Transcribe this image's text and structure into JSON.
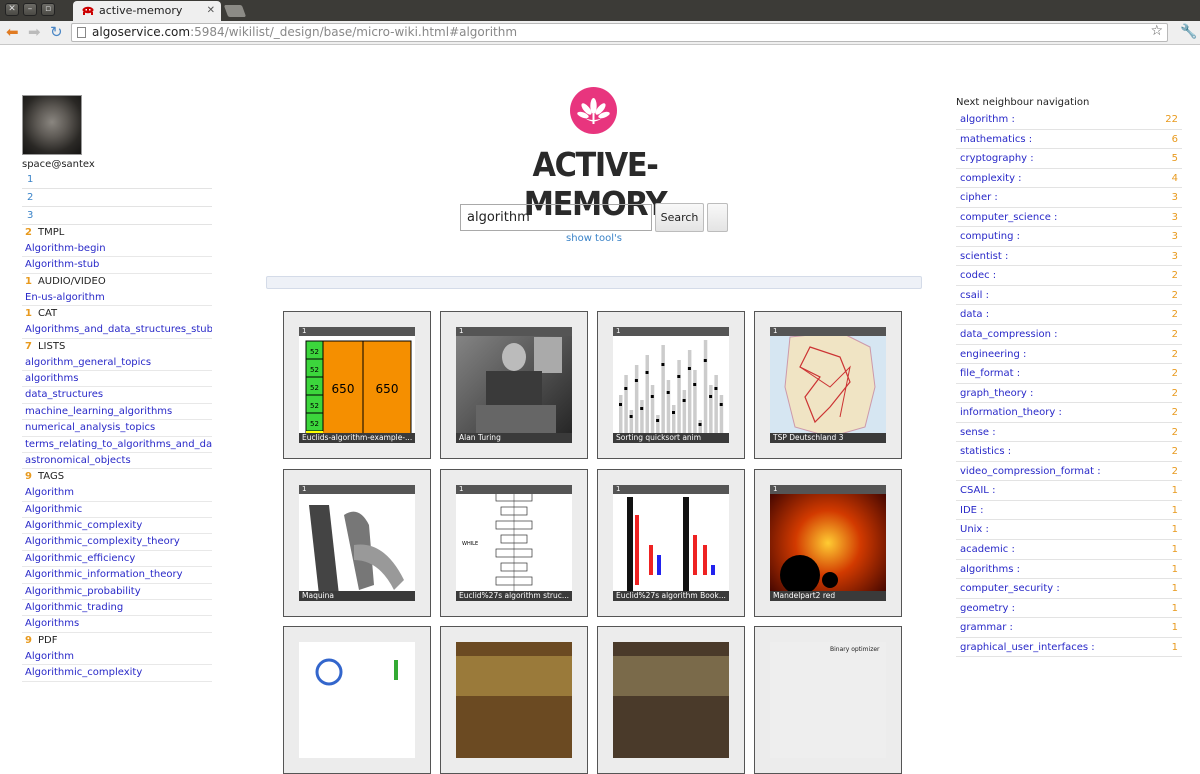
{
  "browser": {
    "tab_title": "active-memory",
    "url_host": "algoservice.com",
    "url_rest": ":5984/wikilist/_design/base/micro-wiki.html#algorithm"
  },
  "left": {
    "username": "space@santex",
    "pages": [
      "1",
      "2",
      "3"
    ],
    "sections": [
      {
        "count": "2",
        "name": "TMPL",
        "items": [
          "Algorithm-begin",
          "Algorithm-stub"
        ]
      },
      {
        "count": "1",
        "name": "AUDIO/VIDEO",
        "items": [
          "En-us-algorithm"
        ]
      },
      {
        "count": "1",
        "name": "CAT",
        "items": [
          "Algorithms_and_data_structures_stubs"
        ]
      },
      {
        "count": "7",
        "name": "LISTS",
        "items": [
          "algorithm_general_topics",
          "algorithms",
          "data_structures",
          "machine_learning_algorithms",
          "numerical_analysis_topics",
          "terms_relating_to_algorithms_and_data_stru",
          "astronomical_objects"
        ]
      },
      {
        "count": "9",
        "name": "TAGS",
        "items": [
          "Algorithm",
          "Algorithmic",
          "Algorithmic_complexity",
          "Algorithmic_complexity_theory",
          "Algorithmic_efficiency",
          "Algorithmic_information_theory",
          "Algorithmic_probability",
          "Algorithmic_trading",
          "Algorithms"
        ]
      },
      {
        "count": "9",
        "name": "PDF",
        "items": [
          "Algorithm",
          "Algorithmic_complexity"
        ]
      }
    ]
  },
  "center": {
    "logo_text": "ACTIVE-MEMORY",
    "search_value": "algorithm",
    "search_button": "Search",
    "show_tools": "show tool's",
    "cards": [
      {
        "badge": "1",
        "caption": "Euclids-algorithm-example-...",
        "icon": "euclid-bars-image"
      },
      {
        "badge": "1",
        "caption": "Alan Turing",
        "icon": "photo-image"
      },
      {
        "badge": "1",
        "caption": "Sorting quicksort anim",
        "icon": "sort-chart-image"
      },
      {
        "badge": "1",
        "caption": "TSP Deutschland 3",
        "icon": "map-image"
      },
      {
        "badge": "1",
        "caption": "Maquina",
        "icon": "machine-image"
      },
      {
        "badge": "1",
        "caption": "Euclid%27s algorithm struc...",
        "icon": "flowchart-image"
      },
      {
        "badge": "1",
        "caption": "Euclid%27s algorithm Book...",
        "icon": "bars-image"
      },
      {
        "badge": "1",
        "caption": "Mandelpart2 red",
        "icon": "fractal-image"
      },
      {
        "badge": "",
        "caption": "",
        "icon": "partial-image"
      },
      {
        "badge": "",
        "caption": "",
        "icon": "partial-image"
      },
      {
        "badge": "",
        "caption": "",
        "icon": "partial-image"
      },
      {
        "badge": "",
        "caption": "Binary optimizer",
        "icon": "partial-image"
      }
    ],
    "euclid_values": [
      "52",
      "52",
      "52",
      "52",
      "52",
      "650",
      "650"
    ]
  },
  "right": {
    "title": "Next neighbour navigation",
    "items": [
      {
        "label": "algorithm",
        "count": "22"
      },
      {
        "label": "mathematics",
        "count": "6"
      },
      {
        "label": "cryptography",
        "count": "5"
      },
      {
        "label": "complexity",
        "count": "4"
      },
      {
        "label": "cipher",
        "count": "3"
      },
      {
        "label": "computer_science",
        "count": "3"
      },
      {
        "label": "computing",
        "count": "3"
      },
      {
        "label": "scientist",
        "count": "3"
      },
      {
        "label": "codec",
        "count": "2"
      },
      {
        "label": "csail",
        "count": "2"
      },
      {
        "label": "data",
        "count": "2"
      },
      {
        "label": "data_compression",
        "count": "2"
      },
      {
        "label": "engineering",
        "count": "2"
      },
      {
        "label": "file_format",
        "count": "2"
      },
      {
        "label": "graph_theory",
        "count": "2"
      },
      {
        "label": "information_theory",
        "count": "2"
      },
      {
        "label": "sense",
        "count": "2"
      },
      {
        "label": "statistics",
        "count": "2"
      },
      {
        "label": "video_compression_format",
        "count": "2"
      },
      {
        "label": "CSAIL",
        "count": "1"
      },
      {
        "label": "IDE",
        "count": "1"
      },
      {
        "label": "Unix",
        "count": "1"
      },
      {
        "label": "academic",
        "count": "1"
      },
      {
        "label": "algorithms",
        "count": "1"
      },
      {
        "label": "computer_security",
        "count": "1"
      },
      {
        "label": "geometry",
        "count": "1"
      },
      {
        "label": "grammar",
        "count": "1"
      },
      {
        "label": "graphical_user_interfaces",
        "count": "1"
      }
    ]
  },
  "colors": {
    "accent": "#e8357e",
    "count": "#e89a1e",
    "link": "#2828c8",
    "nav_link": "#3a83c8"
  }
}
